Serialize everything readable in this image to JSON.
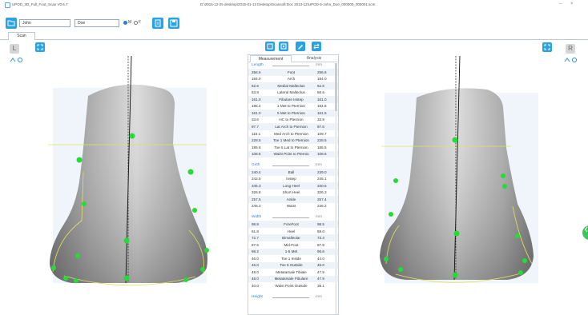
{
  "window": {
    "app_title": "UPOD_3D_Full_Foot_Scan V0.6.7",
    "path": "D:\\2015-12-25 desktop\\2015-01-13 Desktop\\Scansoft Doc 2013-12\\UPOD-5-John_Doe_000000_000001.scm",
    "minimize_glyph": "–",
    "close_glyph": "×"
  },
  "toolbar": {
    "first_name": "John",
    "last_name": "Doe",
    "gender_m": "M",
    "gender_f": "F",
    "gender_selected": "M"
  },
  "tabs": {
    "scan": "Scan"
  },
  "views": {
    "left_label": "L",
    "right_label": "R"
  },
  "panel": {
    "tab_measurement": "Measurement",
    "tab_analysis": "Analysis",
    "sections": [
      {
        "title": "Length",
        "unit": "mm",
        "rows": [
          {
            "l": "256.6",
            "name": "Foot",
            "r": "256.6"
          },
          {
            "l": "184.0",
            "name": "Arch",
            "r": "184.0"
          },
          {
            "l": "62.6",
            "name": "Medial Malleolus",
            "r": "62.6"
          },
          {
            "l": "53.8",
            "name": "Lateral Malleolus",
            "r": "56.6"
          },
          {
            "l": "161.0",
            "name": "Fibulare Instep",
            "r": "161.0"
          },
          {
            "l": "185.2",
            "name": "1 Met to Pternion",
            "r": "184.8"
          },
          {
            "l": "161.0",
            "name": "5 Met to Pternion",
            "r": "161.5"
          },
          {
            "l": "33.6",
            "name": "HC to Pternion",
            "r": "33.9"
          },
          {
            "l": "97.7",
            "name": "Lat Arch to Pternion",
            "r": "97.6"
          },
          {
            "l": "110.1",
            "name": "Med Arch to Pternion",
            "r": "109.7"
          },
          {
            "l": "228.5",
            "name": "Toe 1 Med to Pternion",
            "r": "228.5"
          },
          {
            "l": "185.6",
            "name": "Toe 5 Lat to Pternion",
            "r": "185.5"
          },
          {
            "l": "108.6",
            "name": "Waist Point to Pternio",
            "r": "108.6"
          }
        ]
      },
      {
        "title": "Girth",
        "unit": "mm",
        "rows": [
          {
            "l": "240.4",
            "name": "Ball",
            "r": "239.0"
          },
          {
            "l": "242.5",
            "name": "Instep",
            "r": "245.1"
          },
          {
            "l": "345.3",
            "name": "Long Heel",
            "r": "340.6"
          },
          {
            "l": "326.8",
            "name": "Short Heel",
            "r": "326.3"
          },
          {
            "l": "257.5",
            "name": "Ankle",
            "r": "257.4"
          },
          {
            "l": "245.3",
            "name": "Waist",
            "r": "246.2"
          }
        ]
      },
      {
        "title": "Width",
        "unit": "mm",
        "rows": [
          {
            "l": "98.8",
            "name": "ForeFoot",
            "r": "98.5"
          },
          {
            "l": "61.8",
            "name": "Heel",
            "r": "59.0"
          },
          {
            "l": "72.7",
            "name": "Bimalleolar",
            "r": "73.3"
          },
          {
            "l": "87.5",
            "name": "Mid-Foot",
            "r": "87.9"
          },
          {
            "l": "98.2",
            "name": "1-5 Met",
            "r": "96.6"
          },
          {
            "l": "46.0",
            "name": "Toe 1 Inside",
            "r": "44.0"
          },
          {
            "l": "45.0",
            "name": "Toe 5 Outside",
            "r": "45.0"
          },
          {
            "l": "48.0",
            "name": "Metatarsale Tibiale",
            "r": "47.9"
          },
          {
            "l": "48.0",
            "name": "Metatarsale Fibulare",
            "r": "47.9"
          },
          {
            "l": "40.0",
            "name": "Waist Point Outside",
            "r": "38.1"
          }
        ]
      },
      {
        "title": "Height",
        "unit": "mm",
        "rows": []
      }
    ]
  },
  "colors": {
    "accent": "#2aa3e0",
    "marker": "#22dd33",
    "guide_line": "#e0e060",
    "foot_light": "#d9d9d9",
    "foot_dark": "#6f6f6f"
  },
  "icons": {
    "folder": "folder-icon",
    "clipboard": "clipboard-icon",
    "save": "save-icon",
    "fit": "fit-view-icon",
    "rotate": "rotate-icon",
    "tool1": "view-front-icon",
    "tool2": "view-side-icon",
    "tool3": "pen-icon",
    "tool4": "swap-icon"
  }
}
